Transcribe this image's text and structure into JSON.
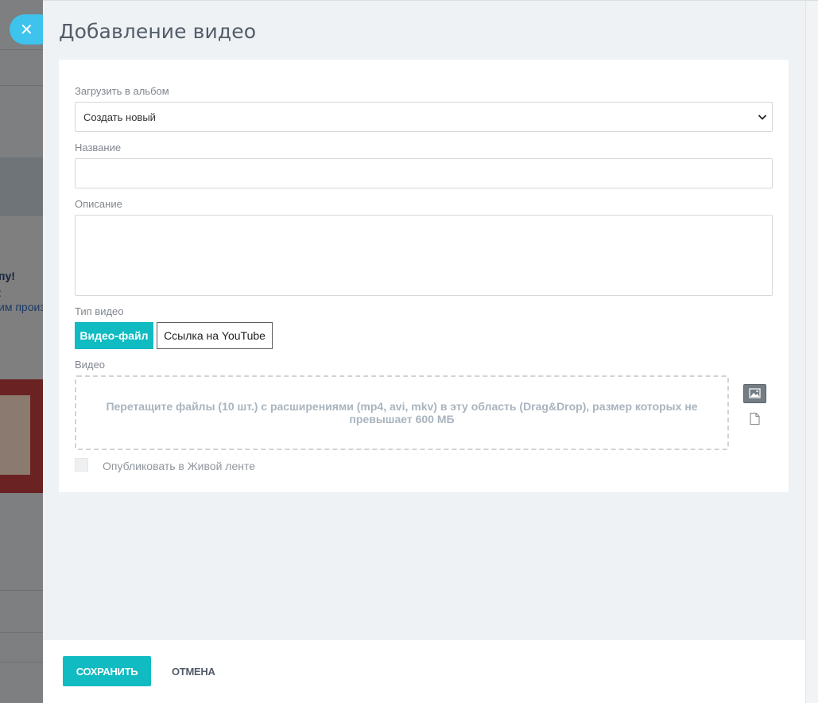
{
  "background_page": {
    "text_1": "пу!",
    "text_2": ":",
    "text_3": "им произ"
  },
  "close_button": {
    "icon": "close-icon",
    "glyph": "✕"
  },
  "slider": {
    "title": "Добавление видео",
    "album": {
      "label": "Загрузить в альбом",
      "selected": "Создать новый"
    },
    "name": {
      "label": "Название",
      "value": ""
    },
    "description": {
      "label": "Описание",
      "value": ""
    },
    "video_type": {
      "label": "Тип видео",
      "options": [
        "Видео-файл",
        "Ссылка на YouTube"
      ],
      "active": "Видео-файл"
    },
    "video": {
      "label": "Видео",
      "dropzone_text": "Перетащите файлы (10 шт.) с расширениями (mp4, avi, mkv) в эту область (Drag&Drop), размер которых не превышает 600 МБ",
      "icons": [
        "image-icon",
        "file-icon"
      ]
    },
    "publish": {
      "label": "Опубликовать в Живой ленте",
      "checked": false
    }
  },
  "footer": {
    "save_label": "СОХРАНИТЬ",
    "cancel_label": "ОТМЕНА"
  },
  "colors": {
    "accent": "#11bbc2",
    "close_button": "#3ec3ec",
    "panel_bg": "#eef2f4"
  }
}
